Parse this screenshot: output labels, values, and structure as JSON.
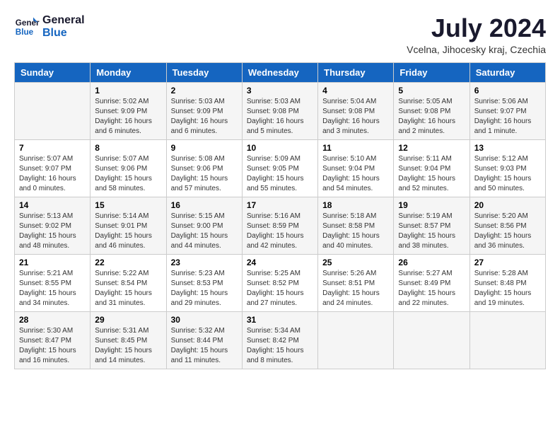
{
  "header": {
    "logo_line1": "General",
    "logo_line2": "Blue",
    "month": "July 2024",
    "location": "Vcelna, Jihocesky kraj, Czechia"
  },
  "days_of_week": [
    "Sunday",
    "Monday",
    "Tuesday",
    "Wednesday",
    "Thursday",
    "Friday",
    "Saturday"
  ],
  "weeks": [
    [
      {
        "day": "",
        "info": ""
      },
      {
        "day": "1",
        "info": "Sunrise: 5:02 AM\nSunset: 9:09 PM\nDaylight: 16 hours\nand 6 minutes."
      },
      {
        "day": "2",
        "info": "Sunrise: 5:03 AM\nSunset: 9:09 PM\nDaylight: 16 hours\nand 6 minutes."
      },
      {
        "day": "3",
        "info": "Sunrise: 5:03 AM\nSunset: 9:08 PM\nDaylight: 16 hours\nand 5 minutes."
      },
      {
        "day": "4",
        "info": "Sunrise: 5:04 AM\nSunset: 9:08 PM\nDaylight: 16 hours\nand 3 minutes."
      },
      {
        "day": "5",
        "info": "Sunrise: 5:05 AM\nSunset: 9:08 PM\nDaylight: 16 hours\nand 2 minutes."
      },
      {
        "day": "6",
        "info": "Sunrise: 5:06 AM\nSunset: 9:07 PM\nDaylight: 16 hours\nand 1 minute."
      }
    ],
    [
      {
        "day": "7",
        "info": "Sunrise: 5:07 AM\nSunset: 9:07 PM\nDaylight: 16 hours\nand 0 minutes."
      },
      {
        "day": "8",
        "info": "Sunrise: 5:07 AM\nSunset: 9:06 PM\nDaylight: 15 hours\nand 58 minutes."
      },
      {
        "day": "9",
        "info": "Sunrise: 5:08 AM\nSunset: 9:06 PM\nDaylight: 15 hours\nand 57 minutes."
      },
      {
        "day": "10",
        "info": "Sunrise: 5:09 AM\nSunset: 9:05 PM\nDaylight: 15 hours\nand 55 minutes."
      },
      {
        "day": "11",
        "info": "Sunrise: 5:10 AM\nSunset: 9:04 PM\nDaylight: 15 hours\nand 54 minutes."
      },
      {
        "day": "12",
        "info": "Sunrise: 5:11 AM\nSunset: 9:04 PM\nDaylight: 15 hours\nand 52 minutes."
      },
      {
        "day": "13",
        "info": "Sunrise: 5:12 AM\nSunset: 9:03 PM\nDaylight: 15 hours\nand 50 minutes."
      }
    ],
    [
      {
        "day": "14",
        "info": "Sunrise: 5:13 AM\nSunset: 9:02 PM\nDaylight: 15 hours\nand 48 minutes."
      },
      {
        "day": "15",
        "info": "Sunrise: 5:14 AM\nSunset: 9:01 PM\nDaylight: 15 hours\nand 46 minutes."
      },
      {
        "day": "16",
        "info": "Sunrise: 5:15 AM\nSunset: 9:00 PM\nDaylight: 15 hours\nand 44 minutes."
      },
      {
        "day": "17",
        "info": "Sunrise: 5:16 AM\nSunset: 8:59 PM\nDaylight: 15 hours\nand 42 minutes."
      },
      {
        "day": "18",
        "info": "Sunrise: 5:18 AM\nSunset: 8:58 PM\nDaylight: 15 hours\nand 40 minutes."
      },
      {
        "day": "19",
        "info": "Sunrise: 5:19 AM\nSunset: 8:57 PM\nDaylight: 15 hours\nand 38 minutes."
      },
      {
        "day": "20",
        "info": "Sunrise: 5:20 AM\nSunset: 8:56 PM\nDaylight: 15 hours\nand 36 minutes."
      }
    ],
    [
      {
        "day": "21",
        "info": "Sunrise: 5:21 AM\nSunset: 8:55 PM\nDaylight: 15 hours\nand 34 minutes."
      },
      {
        "day": "22",
        "info": "Sunrise: 5:22 AM\nSunset: 8:54 PM\nDaylight: 15 hours\nand 31 minutes."
      },
      {
        "day": "23",
        "info": "Sunrise: 5:23 AM\nSunset: 8:53 PM\nDaylight: 15 hours\nand 29 minutes."
      },
      {
        "day": "24",
        "info": "Sunrise: 5:25 AM\nSunset: 8:52 PM\nDaylight: 15 hours\nand 27 minutes."
      },
      {
        "day": "25",
        "info": "Sunrise: 5:26 AM\nSunset: 8:51 PM\nDaylight: 15 hours\nand 24 minutes."
      },
      {
        "day": "26",
        "info": "Sunrise: 5:27 AM\nSunset: 8:49 PM\nDaylight: 15 hours\nand 22 minutes."
      },
      {
        "day": "27",
        "info": "Sunrise: 5:28 AM\nSunset: 8:48 PM\nDaylight: 15 hours\nand 19 minutes."
      }
    ],
    [
      {
        "day": "28",
        "info": "Sunrise: 5:30 AM\nSunset: 8:47 PM\nDaylight: 15 hours\nand 16 minutes."
      },
      {
        "day": "29",
        "info": "Sunrise: 5:31 AM\nSunset: 8:45 PM\nDaylight: 15 hours\nand 14 minutes."
      },
      {
        "day": "30",
        "info": "Sunrise: 5:32 AM\nSunset: 8:44 PM\nDaylight: 15 hours\nand 11 minutes."
      },
      {
        "day": "31",
        "info": "Sunrise: 5:34 AM\nSunset: 8:42 PM\nDaylight: 15 hours\nand 8 minutes."
      },
      {
        "day": "",
        "info": ""
      },
      {
        "day": "",
        "info": ""
      },
      {
        "day": "",
        "info": ""
      }
    ]
  ]
}
